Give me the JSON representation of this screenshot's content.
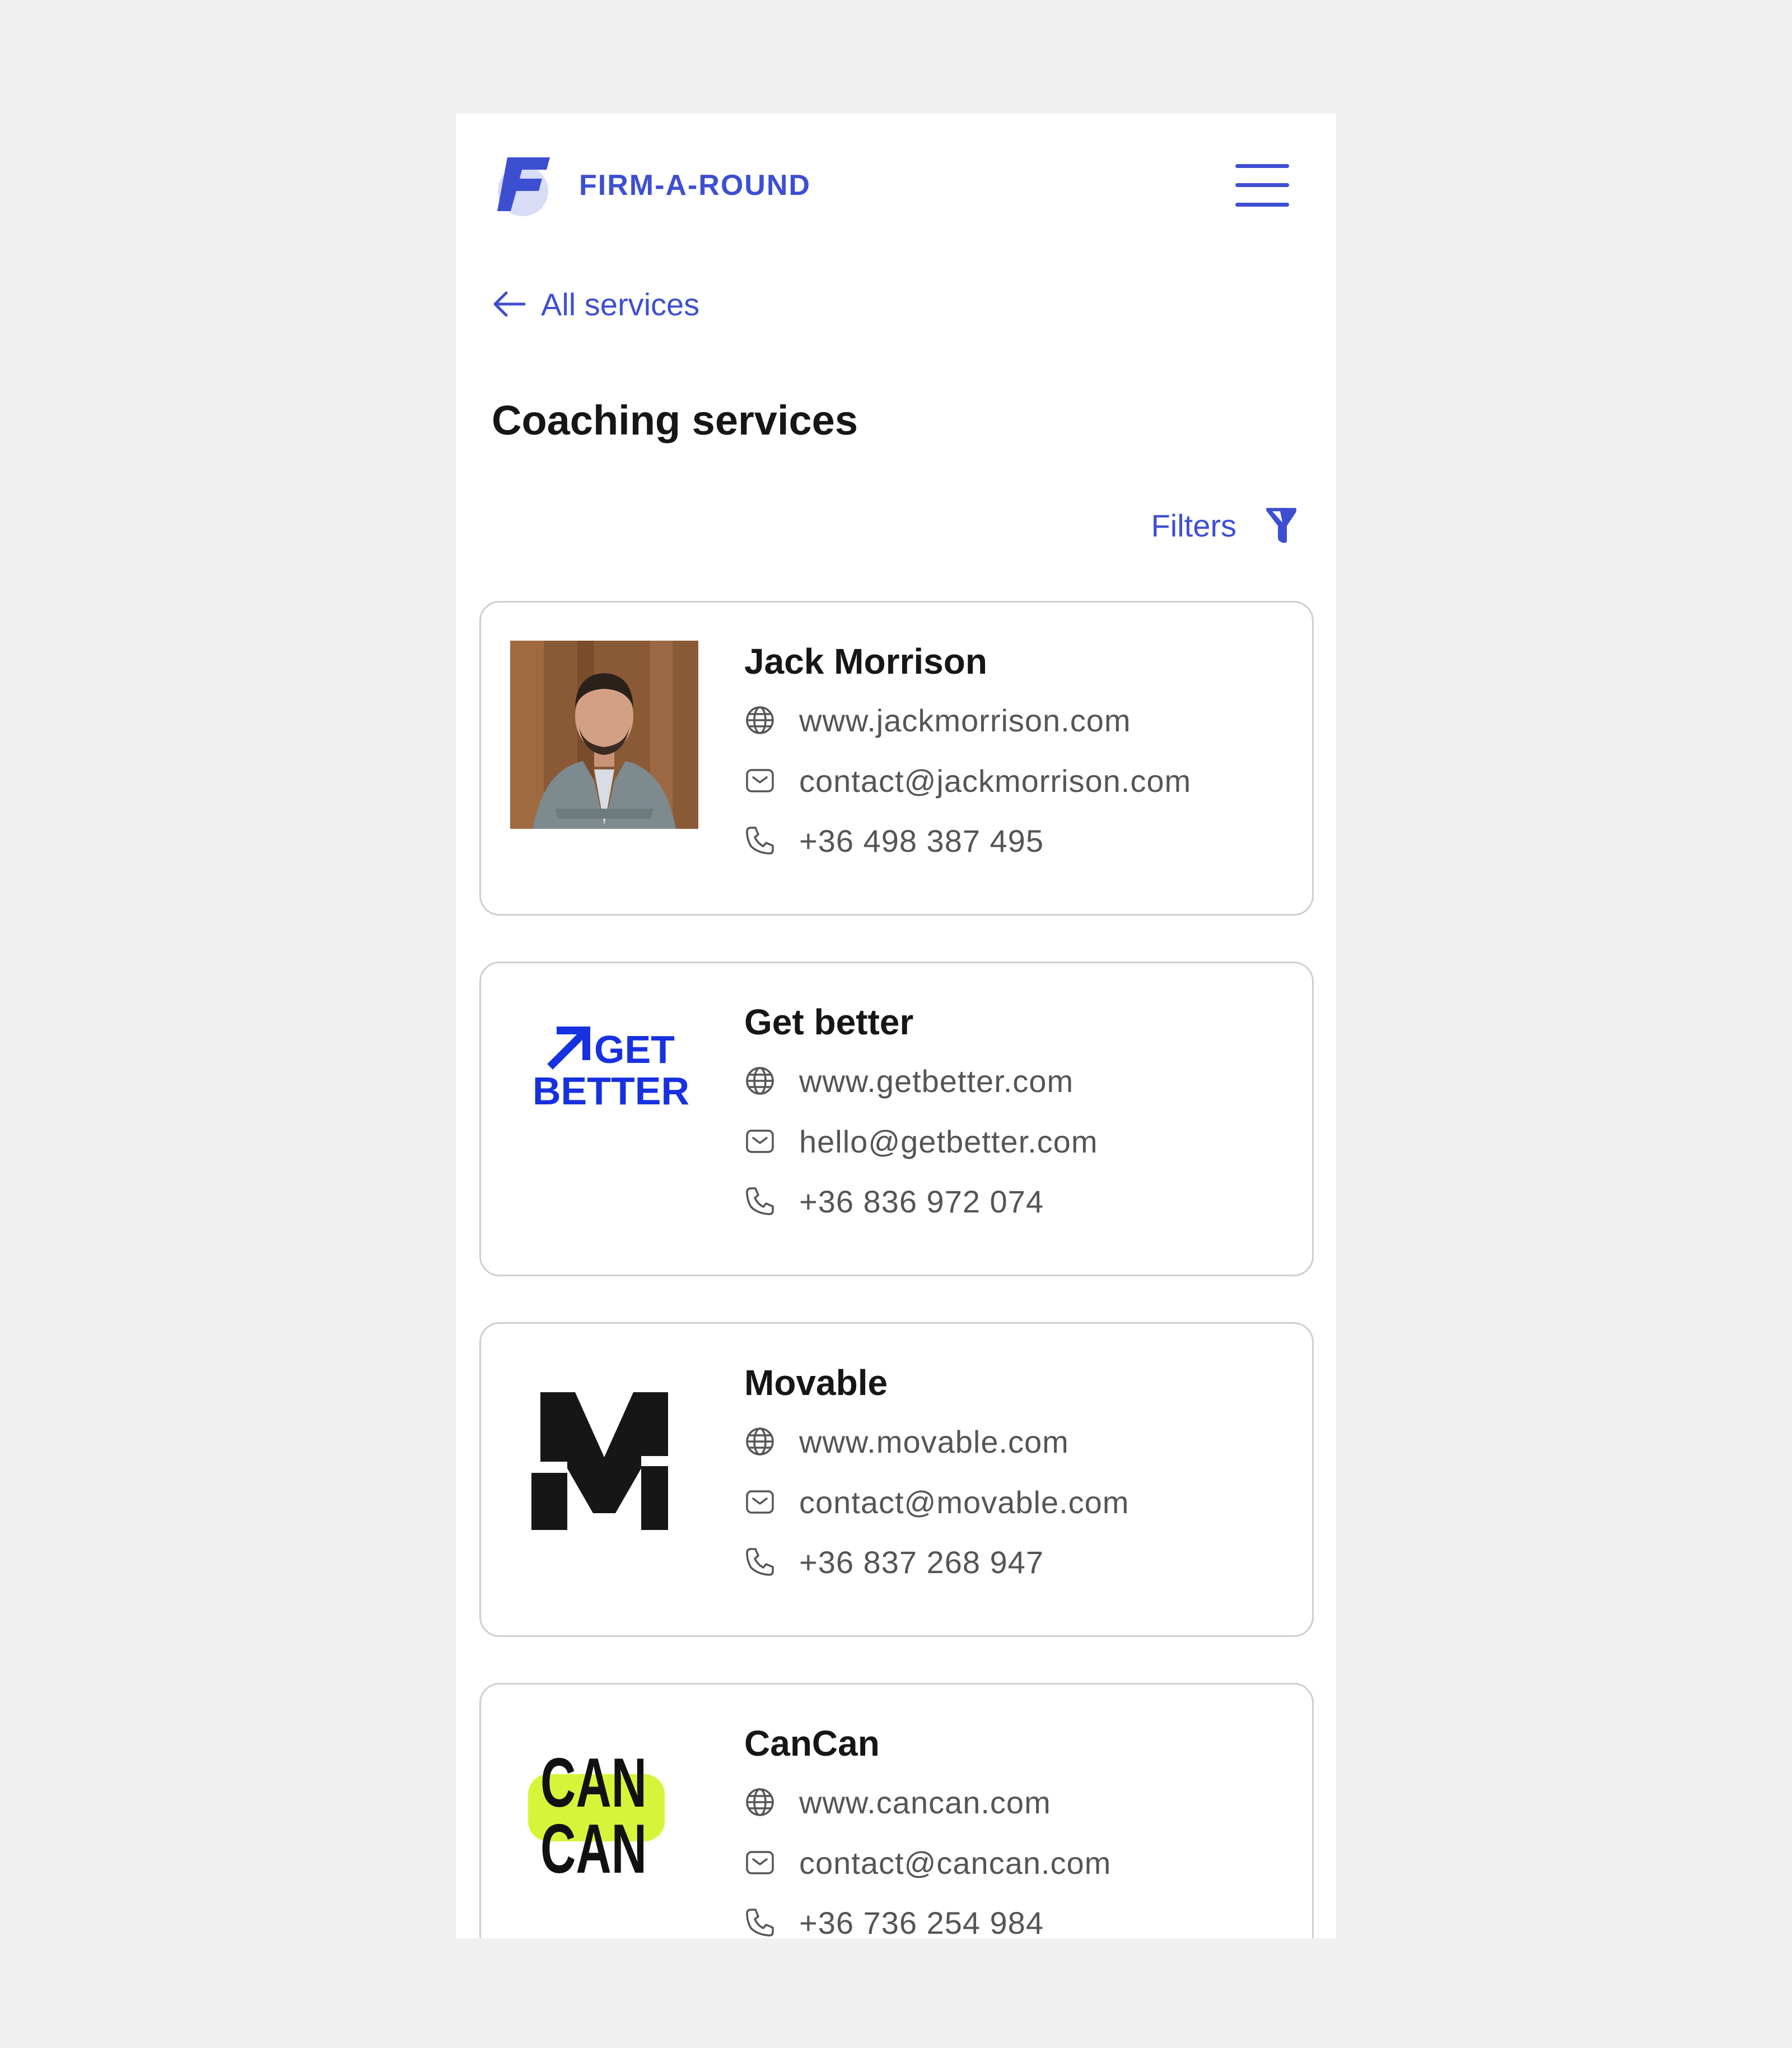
{
  "brand": {
    "name": "FIRM-A-ROUND",
    "accent": "#3d4fd1"
  },
  "nav": {
    "back_label": "All services",
    "menu_icon": "hamburger-menu-icon"
  },
  "page": {
    "title": "Coaching services",
    "filters_label": "Filters"
  },
  "cards": [
    {
      "name": "Jack Morrison",
      "website": "www.jackmorrison.com",
      "email": "contact@jackmorrison.com",
      "phone": "+36 498 387 495",
      "image": "portrait-photo"
    },
    {
      "name": "Get better",
      "website": "www.getbetter.com",
      "email": "hello@getbetter.com",
      "phone": "+36 836 972 074",
      "image": "get-better-logo",
      "logo_text": [
        "GET",
        "BETTER"
      ],
      "logo_color": "#1731e0"
    },
    {
      "name": "Movable",
      "website": "www.movable.com",
      "email": "contact@movable.com",
      "phone": "+36 837 268 947",
      "image": "movable-logo"
    },
    {
      "name": "CanCan",
      "website": "www.cancan.com",
      "email": "contact@cancan.com",
      "phone": "+36 736 254 984",
      "image": "cancan-logo",
      "logo_text": [
        "CAN",
        "CAN"
      ],
      "logo_highlight": "#d6f53a"
    }
  ]
}
